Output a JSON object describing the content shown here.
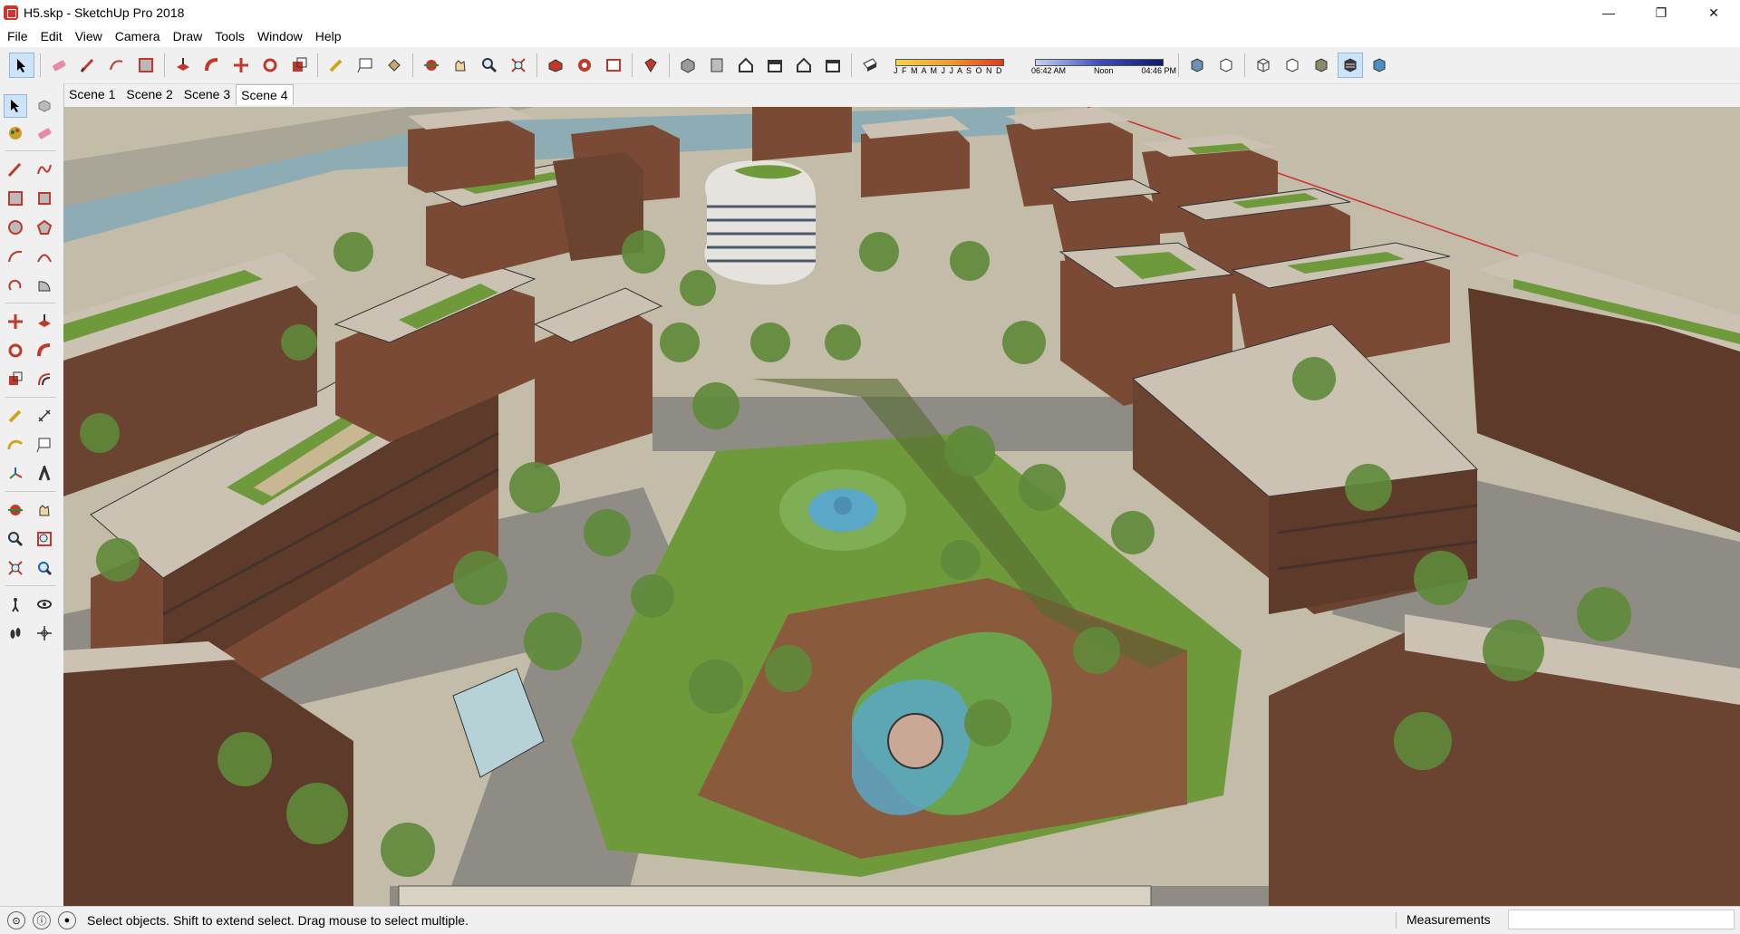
{
  "window": {
    "title": "H5.skp - SketchUp Pro 2018",
    "min_glyph": "—",
    "max_glyph": "❐",
    "close_glyph": "✕"
  },
  "menu": [
    "File",
    "Edit",
    "View",
    "Camera",
    "Draw",
    "Tools",
    "Window",
    "Help"
  ],
  "toolbar": {
    "icons": [
      "select-arrow-icon",
      "eraser-icon",
      "pencil-line-icon",
      "freehand-icon",
      "rectangle-icon",
      "push-pull-icon",
      "follow-me-icon",
      "move-icon",
      "rotate-icon",
      "scale-icon",
      "tape-measure-icon",
      "text-label-icon",
      "paint-bucket-icon",
      "orbit-icon",
      "pan-icon",
      "zoom-icon",
      "zoom-extents-icon",
      "warehouse-icon",
      "extension-warehouse-icon",
      "send-to-layout-icon",
      "ruby-icon",
      "iso-view-icon",
      "top-view-icon",
      "front-view-icon",
      "right-view-icon",
      "back-view-icon",
      "left-view-icon",
      "shadow-toggle-icon",
      "xray-icon",
      "back-edges-icon",
      "wireframe-icon",
      "hidden-line-icon",
      "shaded-icon",
      "shaded-textures-icon",
      "monochrome-icon"
    ],
    "shadow_months": "J F M A M J J A S O N D",
    "time_start": "06:42 AM",
    "time_mid": "Noon",
    "time_end": "04:46 PM"
  },
  "scenes": [
    "Scene 1",
    "Scene 2",
    "Scene 3",
    "Scene 4"
  ],
  "active_scene": "Scene 4",
  "status": {
    "message": "Select objects. Shift to extend select. Drag mouse to select multiple.",
    "measurements_label": "Measurements",
    "measurements_value": ""
  },
  "colors": {
    "accent": "#cde3f7",
    "brick": "#7a4a35",
    "roof": "#cbc2b4",
    "grass": "#6f9a3c",
    "water": "#5aa7c7",
    "deck": "#8a5a3c"
  }
}
